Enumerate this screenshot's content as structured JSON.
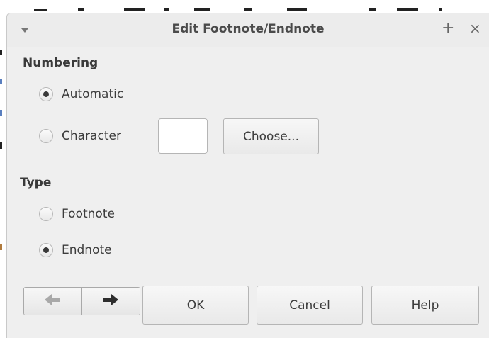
{
  "dialog": {
    "title": "Edit Footnote/Endnote",
    "menu_icon": "chevron-down-icon",
    "maximize_symbol": "+",
    "close_symbol": "×"
  },
  "numbering": {
    "label": "Numbering",
    "options": [
      {
        "label": "Automatic",
        "selected": true
      },
      {
        "label": "Character",
        "selected": false
      }
    ],
    "character_value": "",
    "choose_label": "Choose..."
  },
  "type": {
    "label": "Type",
    "options": [
      {
        "label": "Footnote",
        "selected": false
      },
      {
        "label": "Endnote",
        "selected": true
      }
    ]
  },
  "buttons": {
    "previous_icon": "arrow-left-icon",
    "next_icon": "arrow-right-icon",
    "ok": "OK",
    "cancel": "Cancel",
    "help": "Help"
  },
  "colors": {
    "dialog_bg": "#efefef",
    "text": "#3c3c3c",
    "border": "#b5b5b5"
  }
}
